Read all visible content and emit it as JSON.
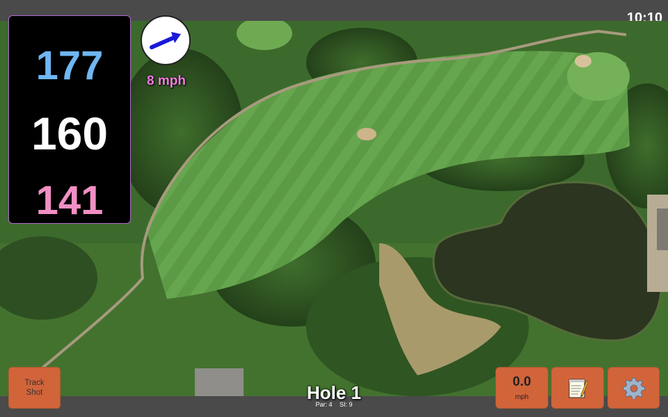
{
  "status": {
    "clock": "10:10"
  },
  "distances": {
    "back": "177",
    "center": "160",
    "front": "141"
  },
  "wind": {
    "speed": "8 mph",
    "arrow_icon": "wind-arrow-icon"
  },
  "hole": {
    "title": "Hole 1",
    "par": "Par: 4",
    "si": "SI: 9"
  },
  "buttons": {
    "track_shot": "Track Shot",
    "speed_value": "0.0",
    "speed_unit": "mph",
    "notes_icon": "notepad-icon",
    "settings_icon": "gear-icon"
  },
  "colors": {
    "back_distance": "#6fb6f2",
    "center_distance": "#ffffff",
    "front_distance": "#f08fc4",
    "wind_text": "#f07ee0",
    "button_bg": "#d2643a"
  }
}
